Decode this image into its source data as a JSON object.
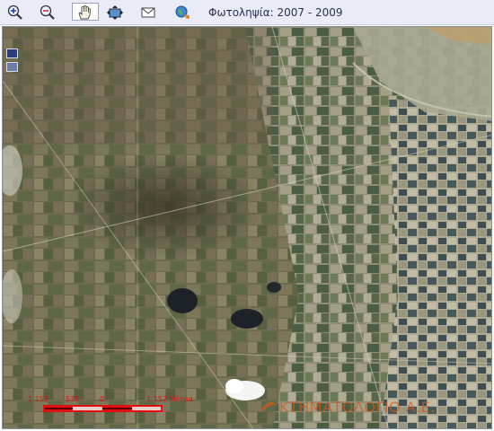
{
  "toolbar": {
    "tools": [
      {
        "name": "zoom-in-icon",
        "active": false
      },
      {
        "name": "zoom-out-icon",
        "active": false
      },
      {
        "name": "pan-hand-icon",
        "active": true
      },
      {
        "name": "full-extent-icon",
        "active": false
      },
      {
        "name": "envelope-icon",
        "active": false
      },
      {
        "name": "globe-refresh-icon",
        "active": false
      }
    ],
    "caption": "Φωτοληψία: 2007 - 2009"
  },
  "map": {
    "layer_buttons": [
      "layer-button-1",
      "layer-button-2"
    ],
    "scale": {
      "label_left": "1.152",
      "label_mid": "576",
      "label_zero": "0",
      "label_right": "1.152 Μέτρα",
      "color": "#e01010"
    },
    "watermark": "ΚΤΗΜΑΤΟΛΟΓΙΟ Α.Ε."
  }
}
